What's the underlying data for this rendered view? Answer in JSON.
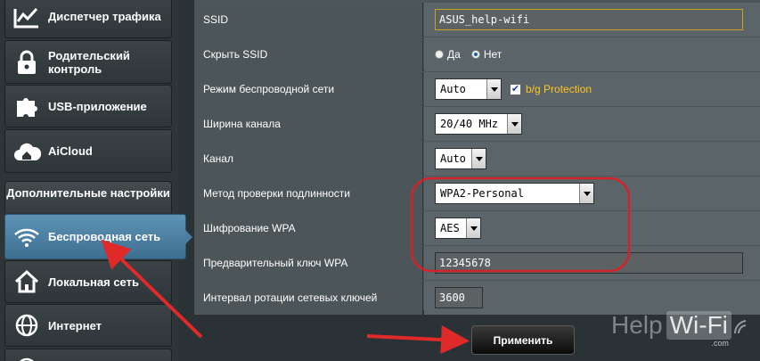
{
  "sidebar": {
    "items": [
      {
        "label": "Диспетчер трафика",
        "icon": "traffic-chart-icon"
      },
      {
        "label": "Родительский контроль",
        "icon": "lock-icon"
      },
      {
        "label": "USB-приложение",
        "icon": "puzzle-icon"
      },
      {
        "label": "AiCloud",
        "icon": "cloud-home-icon"
      }
    ],
    "advanced_header": "Дополнительные настройки",
    "advanced_items": [
      {
        "label": "Беспроводная сеть",
        "icon": "wifi-icon",
        "active": true
      },
      {
        "label": "Локальная сеть",
        "icon": "house-icon"
      },
      {
        "label": "Интернет",
        "icon": "globe-icon"
      }
    ]
  },
  "form": {
    "ssid": {
      "label": "SSID",
      "value": "ASUS_help-wifi"
    },
    "hide_ssid": {
      "label": "Скрыть SSID",
      "option_yes": "Да",
      "option_no": "Нет",
      "selected": "Нет"
    },
    "wireless_mode": {
      "label": "Режим беспроводной сети",
      "value": "Auto",
      "checkbox_checked": true,
      "checkbox_label": "b/g Protection"
    },
    "channel_width": {
      "label": "Ширина канала",
      "value": "20/40 MHz"
    },
    "channel": {
      "label": "Канал",
      "value": "Auto"
    },
    "auth_method": {
      "label": "Метод проверки подлинности",
      "value": "WPA2-Personal"
    },
    "wpa_encryption": {
      "label": "Шифрование WPA",
      "value": "AES"
    },
    "wpa_key": {
      "label": "Предварительный ключ WPA",
      "value": "12345678"
    },
    "key_rotation": {
      "label": "Интервал ротации сетевых ключей",
      "value": "3600"
    }
  },
  "apply_label": "Применить",
  "watermark": {
    "left": "Help",
    "box": "Wi-Fi",
    "suffix": ".com"
  },
  "colors": {
    "highlight_ring": "#d0232a",
    "annotation_arrow": "#e02a2a",
    "active_menu": "#4a7ea0",
    "protection_text": "#ffc61e"
  }
}
